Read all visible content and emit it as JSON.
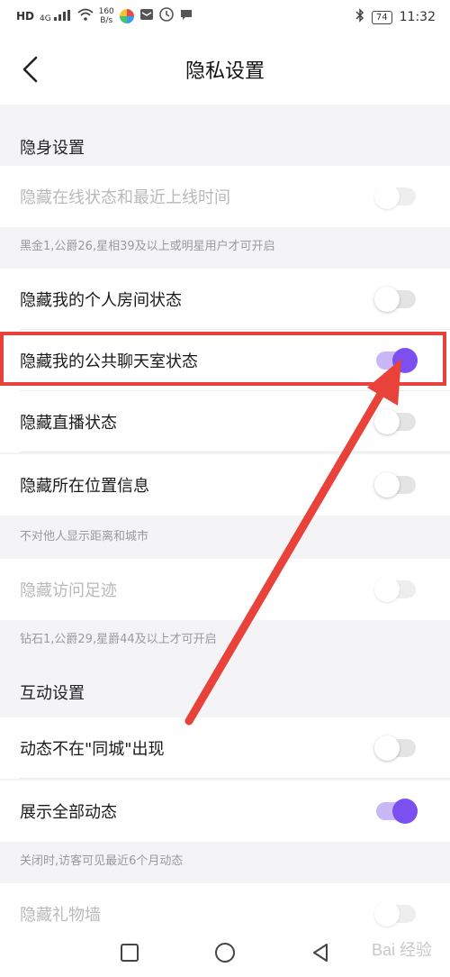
{
  "status_bar": {
    "hd": "HD",
    "signal": "4G",
    "speed_value": "160",
    "speed_unit": "B/s",
    "battery": "74",
    "time": "11:32"
  },
  "header": {
    "title": "隐私设置"
  },
  "sections": {
    "stealth": "隐身设置",
    "interaction": "互动设置"
  },
  "rows": [
    {
      "label": "隐藏在线状态和最近上线时间",
      "state": "off",
      "disabled": true
    },
    {
      "label": "隐藏我的个人房间状态",
      "state": "off",
      "disabled": false
    },
    {
      "label": "隐藏我的公共聊天室状态",
      "state": "on",
      "disabled": false
    },
    {
      "label": "隐藏直播状态",
      "state": "off",
      "disabled": false
    },
    {
      "label": "隐藏所在位置信息",
      "state": "off",
      "disabled": false
    },
    {
      "label": "隐藏访问足迹",
      "state": "off",
      "disabled": true
    },
    {
      "label": "动态不在\"同城\"出现",
      "state": "off",
      "disabled": false
    },
    {
      "label": "展示全部动态",
      "state": "on",
      "disabled": false
    },
    {
      "label": "隐藏礼物墙",
      "state": "off",
      "disabled": true
    }
  ],
  "notes": {
    "online": "黑金1,公爵26,星相39及以上或明星用户才可开启",
    "location": "不对他人显示距离和城市",
    "footprint": "钻石1,公爵29,星爵44及以上才可开启",
    "moments": "关闭时,访客可见最近6个月动态"
  },
  "watermark": "Bai 经验",
  "colors": {
    "accent": "#7b4ff0",
    "accent_track": "#c9b7f7",
    "highlight": "#e8423a"
  }
}
